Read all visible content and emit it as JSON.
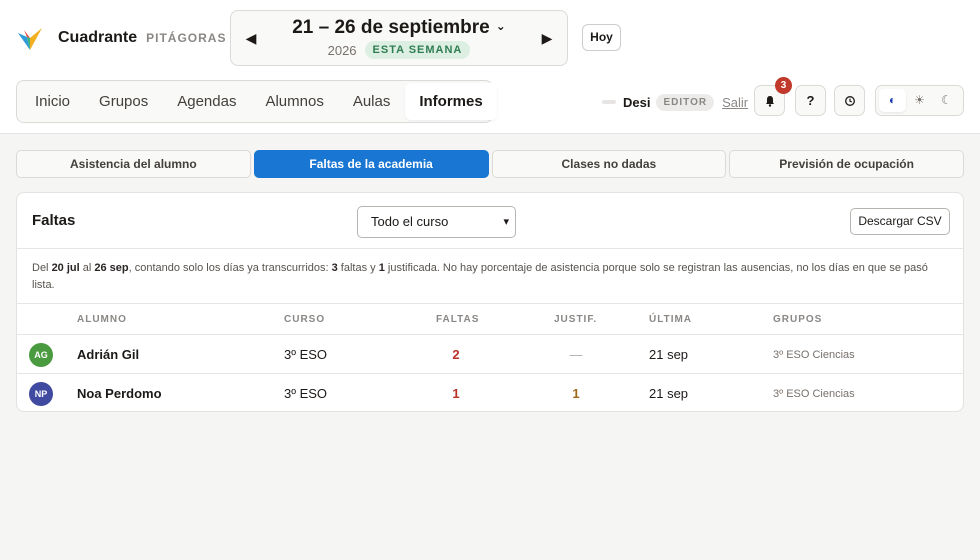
{
  "brand": {
    "name": "Cuadrante",
    "subtitle": "PITÁGORAS"
  },
  "week": {
    "title": "21 – 26 de septiembre",
    "year": "2026",
    "badge": "ESTA SEMANA"
  },
  "today_label": "Hoy",
  "nav": {
    "items": [
      "Inicio",
      "Grupos",
      "Agendas",
      "Alumnos",
      "Aulas",
      "Informes"
    ],
    "active": "Informes"
  },
  "user": {
    "name": "Desi",
    "role": "EDITOR",
    "logout": "Salir"
  },
  "notifications": {
    "count": "3"
  },
  "help_label": "?",
  "report_tabs": [
    "Asistencia del alumno",
    "Faltas de la academia",
    "Clases no dadas",
    "Previsión de ocupación"
  ],
  "active_report_tab": "Faltas de la academia",
  "card": {
    "title": "Faltas",
    "range_value": "Todo el curso",
    "csv_label": "Descargar CSV",
    "summary": {
      "p1": "Del ",
      "from": "20 jul",
      "p2": " al ",
      "to": "26 sep",
      "p3": ", contando solo los días ya transcurridos: ",
      "faltas": "3",
      "p4": " faltas y ",
      "justificadas": "1",
      "p5": " justificada. No hay porcentaje de asistencia porque solo se registran las ausencias, no los días en que se pasó lista."
    }
  },
  "table": {
    "headers": {
      "alumno": "ALUMNO",
      "curso": "CURSO",
      "faltas": "FALTAS",
      "justif": "JUSTIF.",
      "ultima": "ÚLTIMA",
      "grupos": "GRUPOS"
    },
    "rows": [
      {
        "initials": "AG",
        "avatar_color": "#4a9a3f",
        "name": "Adrián Gil",
        "curso": "3º ESO",
        "faltas": "2",
        "justif": "—",
        "ultima": "21 sep",
        "grupos": "3º ESO Ciencias"
      },
      {
        "initials": "NP",
        "avatar_color": "#3f4aa0",
        "name": "Noa Perdomo",
        "curso": "3º ESO",
        "faltas": "1",
        "justif": "1",
        "ultima": "21 sep",
        "grupos": "3º ESO Ciencias"
      }
    ]
  },
  "colors": {
    "accent": "#1976d2",
    "faltas": "#b83227",
    "justif": "#a0691a",
    "badge_green": "#2f7d52"
  }
}
